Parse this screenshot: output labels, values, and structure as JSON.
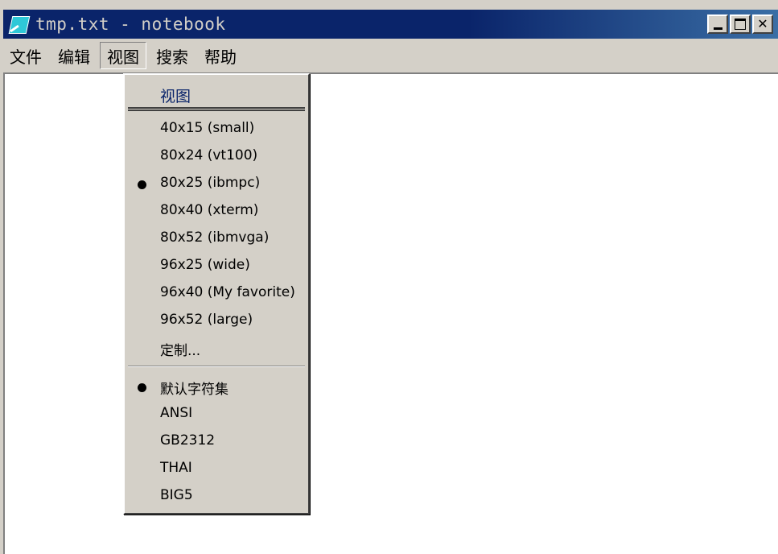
{
  "window": {
    "title": "tmp.txt - notebook",
    "minimize_symbol": "",
    "maximize_symbol": "",
    "close_symbol": "✕"
  },
  "menubar": {
    "items": [
      "文件",
      "编辑",
      "视图",
      "搜索",
      "帮助"
    ],
    "active_index": 2
  },
  "dropdown": {
    "title": "视图",
    "size_items": [
      {
        "label": "40x15 (small)",
        "checked": false
      },
      {
        "label": "80x24 (vt100)",
        "checked": false
      },
      {
        "label": "80x25 (ibmpc)",
        "checked": true
      },
      {
        "label": "80x40 (xterm)",
        "checked": false
      },
      {
        "label": "80x52 (ibmvga)",
        "checked": false
      },
      {
        "label": "96x25 (wide)",
        "checked": false
      },
      {
        "label": "96x40 (My favorite)",
        "checked": false
      },
      {
        "label": "96x52 (large)",
        "checked": false
      },
      {
        "label": "定制...",
        "checked": false
      }
    ],
    "charset_items": [
      {
        "label": "默认字符集",
        "checked": true
      },
      {
        "label": "ANSI",
        "checked": false
      },
      {
        "label": "GB2312",
        "checked": false
      },
      {
        "label": "THAI",
        "checked": false
      },
      {
        "label": "BIG5",
        "checked": false
      }
    ]
  },
  "colors": {
    "titlebar": "#0a246a",
    "face": "#d4d0c8",
    "highlight_text": "#0a246a"
  }
}
